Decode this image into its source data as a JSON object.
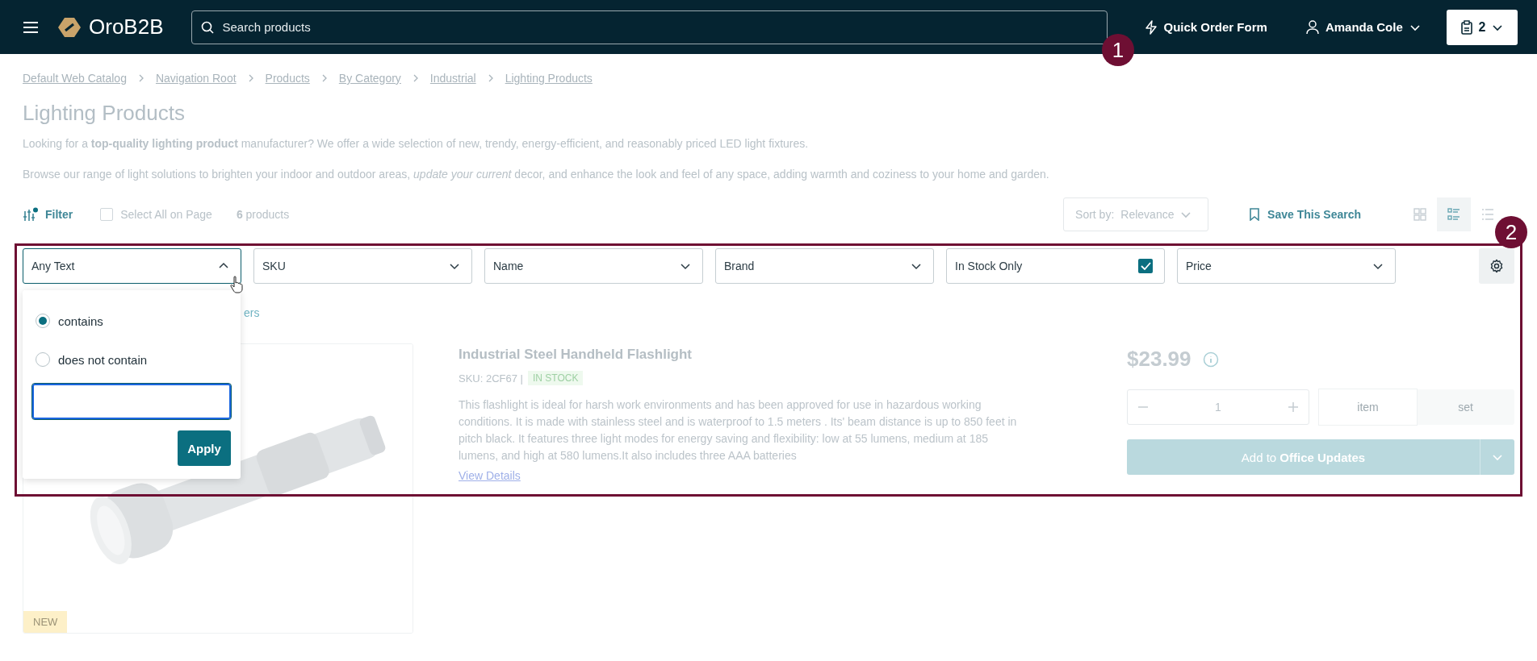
{
  "header": {
    "brand": "OroB2B",
    "search": {
      "placeholder": "Search products"
    },
    "quick_order": "Quick Order Form",
    "user": "Amanda Cole",
    "cart_count": "2"
  },
  "breadcrumbs": [
    "Default Web Catalog",
    "Navigation Root",
    "Products",
    "By Category",
    "Industrial",
    "Lighting Products"
  ],
  "title": "Lighting Products",
  "intro": [
    "Looking for a **top-quality lighting product** manufacturer? We offer a wide selection of new, trendy, energy-efficient, and reasonably priced LED light fixtures.",
    "Browse our range of light solutions to brighten your indoor and outdoor areas, *update your current* decor, and enhance the look and feel of any space, adding warmth and coziness to your home and garden."
  ],
  "toolbar": {
    "filter": "Filter",
    "filter_active": true,
    "select_all": {
      "label": "Select All on Page",
      "checked": false
    },
    "count": "**6** products",
    "sort": {
      "label": "Sort by:",
      "value": "Relevance"
    },
    "save_search": "Save This Search",
    "views": [
      {
        "kind": "grid",
        "selected": false
      },
      {
        "kind": "list",
        "selected": true
      },
      {
        "kind": "compact",
        "selected": false
      }
    ]
  },
  "filters": [
    {
      "kind": "select",
      "label": "Any Text",
      "expanded": true
    },
    {
      "kind": "select",
      "label": "SKU",
      "expanded": false
    },
    {
      "kind": "select",
      "label": "Name",
      "expanded": false
    },
    {
      "kind": "select",
      "label": "Brand",
      "expanded": false
    },
    {
      "kind": "checkbox",
      "label": "In Stock Only",
      "checked": true
    },
    {
      "kind": "select",
      "label": "Price",
      "expanded": false
    }
  ],
  "filter_popup": {
    "options": [
      {
        "label": "contains",
        "selected": true
      },
      {
        "label": "does not contain",
        "selected": false
      }
    ],
    "apply": "Apply"
  },
  "clear_fragment": "ers",
  "product": {
    "title": "Industrial Steel Handheld Flashlight",
    "sku": "SKU: 2CF67 |",
    "stock": "IN STOCK",
    "description": "This flashlight is ideal for harsh work environments and has been approved for use in hazardous working conditions. It is made with stainless steel and is waterproof to 1.5 meters . Its' beam distance is up to 850 feet in pitch black. It features three light modes for energy saving and flexibility: low at 55 lumens, medium at 185 lumens, and high at 580 lumens.It also includes three AAA batteries",
    "link": "View Details",
    "badge": "NEW",
    "price": "$23.99",
    "quantity": "1",
    "units": [
      {
        "label": "item",
        "selected": true
      },
      {
        "label": "set",
        "selected": false
      }
    ],
    "add_button": "Add to **Office Updates**"
  },
  "annotations": [
    {
      "label": "1"
    },
    {
      "label": "2"
    }
  ]
}
